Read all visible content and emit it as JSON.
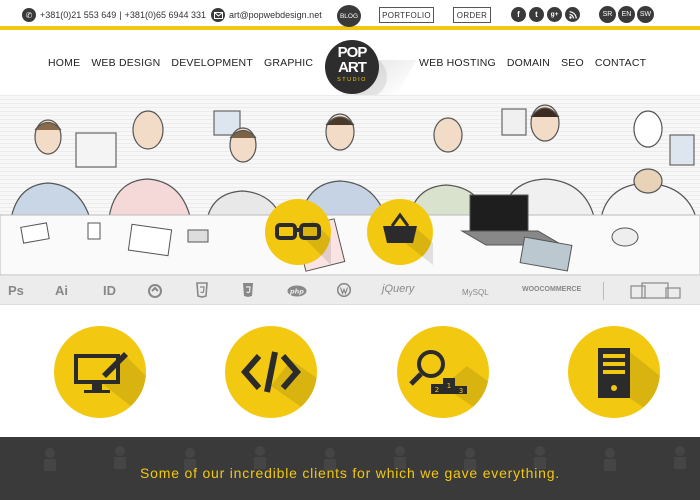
{
  "topbar": {
    "phone1": "+381(0)21 553 649",
    "phone2": "+381(0)65 6944 331",
    "email": "art@popwebdesign.net",
    "blog_label": "BLOG",
    "portfolio_label": "PORTFOLIO",
    "order_label": "ORDER",
    "social": [
      "f",
      "t",
      "g+",
      "rss"
    ],
    "languages": [
      "SR",
      "EN",
      "SW"
    ]
  },
  "nav": {
    "left": [
      "HOME",
      "WEB DESIGN",
      "DEVELOPMENT",
      "GRAPHIC"
    ],
    "right": [
      "WEB HOSTING",
      "DOMAIN",
      "SEO",
      "CONTACT"
    ]
  },
  "logo": {
    "line1": "POP",
    "line2": "ART",
    "line3": "STUDIO"
  },
  "tech_strip": [
    "Ps",
    "Ai",
    "ID",
    "jQuery",
    "MySQL",
    "WOOCOMMERCE"
  ],
  "clients": {
    "text": "Some of our incredible clients for which we gave everything."
  },
  "colors": {
    "accent": "#f2c811",
    "dark": "#3a3a3a"
  },
  "services": [
    "monitor-pen-icon",
    "code-icon",
    "seo-podium-icon",
    "server-icon"
  ],
  "hero_buttons": [
    "glasses-icon",
    "basket-icon"
  ]
}
